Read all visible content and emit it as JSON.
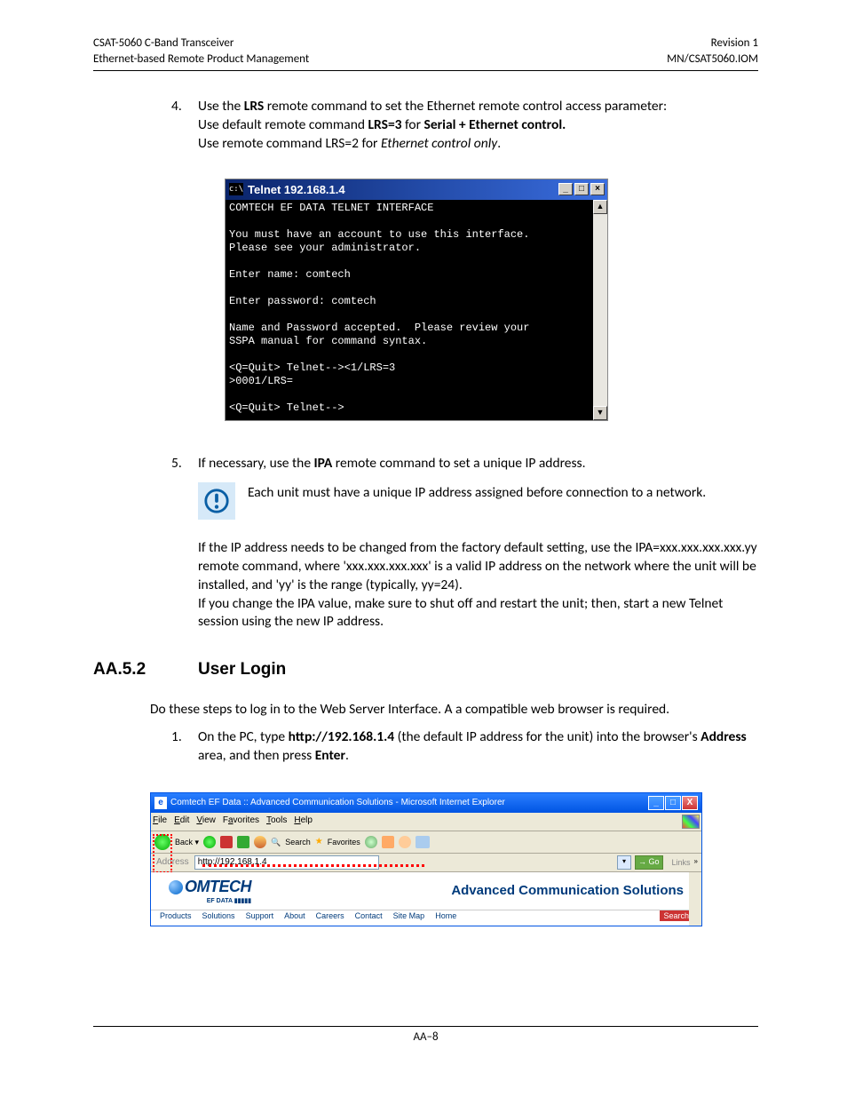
{
  "header": {
    "left_line1": "CSAT-5060 C-Band Transceiver",
    "left_line2": "Ethernet-based Remote Product Management",
    "right_line1": "Revision 1",
    "right_line2": "MN/CSAT5060.IOM"
  },
  "item4": {
    "num": "4.",
    "l1a": "Use the ",
    "l1b": "LRS",
    "l1c": " remote command to set the Ethernet remote control access parameter:",
    "l2a": "Use default remote command ",
    "l2b": "LRS=3",
    "l2c": " for ",
    "l2d": "Serial + Ethernet control.",
    "l3a": "Use remote command LRS=2 for ",
    "l3b": "Ethernet control only",
    "l3c": "."
  },
  "telnet": {
    "icon_text": "c:\\",
    "title": "Telnet 192.168.1.4",
    "min": "_",
    "max": "□",
    "close": "×",
    "body": "COMTECH EF DATA TELNET INTERFACE\n\nYou must have an account to use this interface.\nPlease see your administrator.\n\nEnter name: comtech\n\nEnter password: comtech\n\nName and Password accepted.  Please review your\nSSPA manual for command syntax.\n\n<Q=Quit> Telnet--><1/LRS=3\n>0001/LRS=\n\n<Q=Quit> Telnet-->",
    "up": "▲",
    "down": "▼"
  },
  "item5": {
    "num": "5.",
    "l1a": "If necessary, use the ",
    "l1b": "IPA",
    "l1c": " remote command to set a unique IP address.",
    "note": "Each unit must have a unique IP address assigned before connection to a network.",
    "p2": "If the IP address needs to be changed from the factory default setting, use the IPA=xxx.xxx.xxx.xxx.yy remote command, where 'xxx.xxx.xxx.xxx' is a valid IP address on the network where the unit will be installed, and 'yy' is the range (typically, yy=24).",
    "p3": "If you change the IPA value, make sure to shut off and restart the unit; then, start a new Telnet session using the new IP address."
  },
  "section": {
    "num": "AA.5.2",
    "title": "User Login",
    "intro": "Do these steps to log in to the Web Server Interface. A a compatible web browser is required.",
    "step1": {
      "num": "1.",
      "a": "On the PC, type ",
      "b": "http://192.168.1.4",
      "c": " (the default IP address for the unit) into the browser's ",
      "d": "Address",
      "e": " area, and then press ",
      "f": "Enter",
      "g": "."
    }
  },
  "ie": {
    "title": "Comtech EF Data :: Advanced Communication Solutions - Microsoft Internet Explorer",
    "menu": {
      "file": "File",
      "edit": "Edit",
      "view": "View",
      "fav": "Favorites",
      "tools": "Tools",
      "help": "Help"
    },
    "search_label": "Search",
    "fav_label": "Favorites",
    "addr_label": "Address",
    "addr_value": "http://192.168.1.4",
    "go": "Go",
    "links": "Links",
    "logo_text": "OMTECH",
    "logo_sub": "EF DATA ▮▮▮▮▮",
    "banner": "Advanced Communication Solutions",
    "nav": {
      "products": "Products",
      "solutions": "Solutions",
      "support": "Support",
      "about": "About",
      "careers": "Careers",
      "contact": "Contact",
      "sitemap": "Site Map",
      "home": "Home",
      "search": "Search"
    },
    "min": "_",
    "max": "□",
    "close": "X"
  },
  "footer": "AA–8"
}
